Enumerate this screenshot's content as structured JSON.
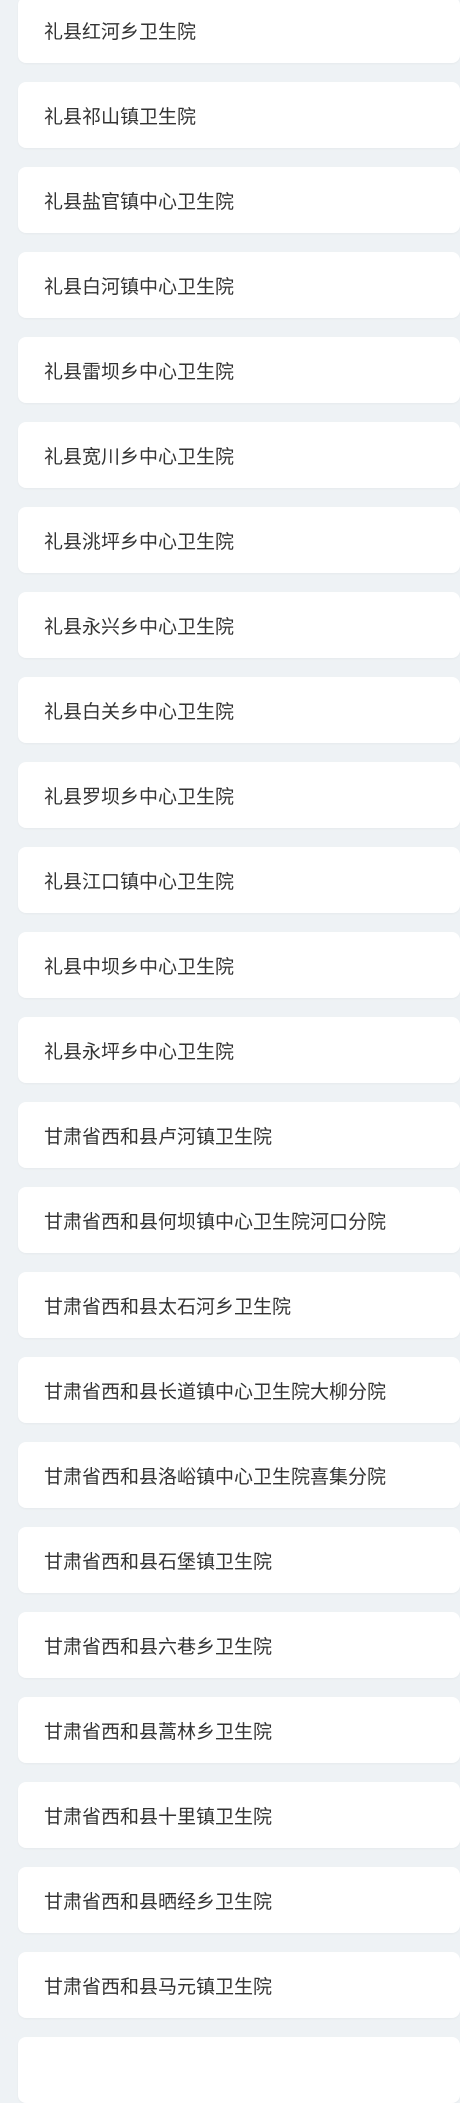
{
  "facilities": [
    "礼县红河乡卫生院",
    "礼县祁山镇卫生院",
    "礼县盐官镇中心卫生院",
    "礼县白河镇中心卫生院",
    "礼县雷坝乡中心卫生院",
    "礼县宽川乡中心卫生院",
    "礼县洮坪乡中心卫生院",
    "礼县永兴乡中心卫生院",
    "礼县白关乡中心卫生院",
    "礼县罗坝乡中心卫生院",
    "礼县江口镇中心卫生院",
    "礼县中坝乡中心卫生院",
    "礼县永坪乡中心卫生院",
    "甘肃省西和县卢河镇卫生院",
    "甘肃省西和县何坝镇中心卫生院河口分院",
    "甘肃省西和县太石河乡卫生院",
    "甘肃省西和县长道镇中心卫生院大柳分院",
    "甘肃省西和县洛峪镇中心卫生院喜集分院",
    "甘肃省西和县石堡镇卫生院",
    "甘肃省西和县六巷乡卫生院",
    "甘肃省西和县蒿林乡卫生院",
    "甘肃省西和县十里镇卫生院",
    "甘肃省西和县晒经乡卫生院",
    "甘肃省西和县马元镇卫生院"
  ]
}
